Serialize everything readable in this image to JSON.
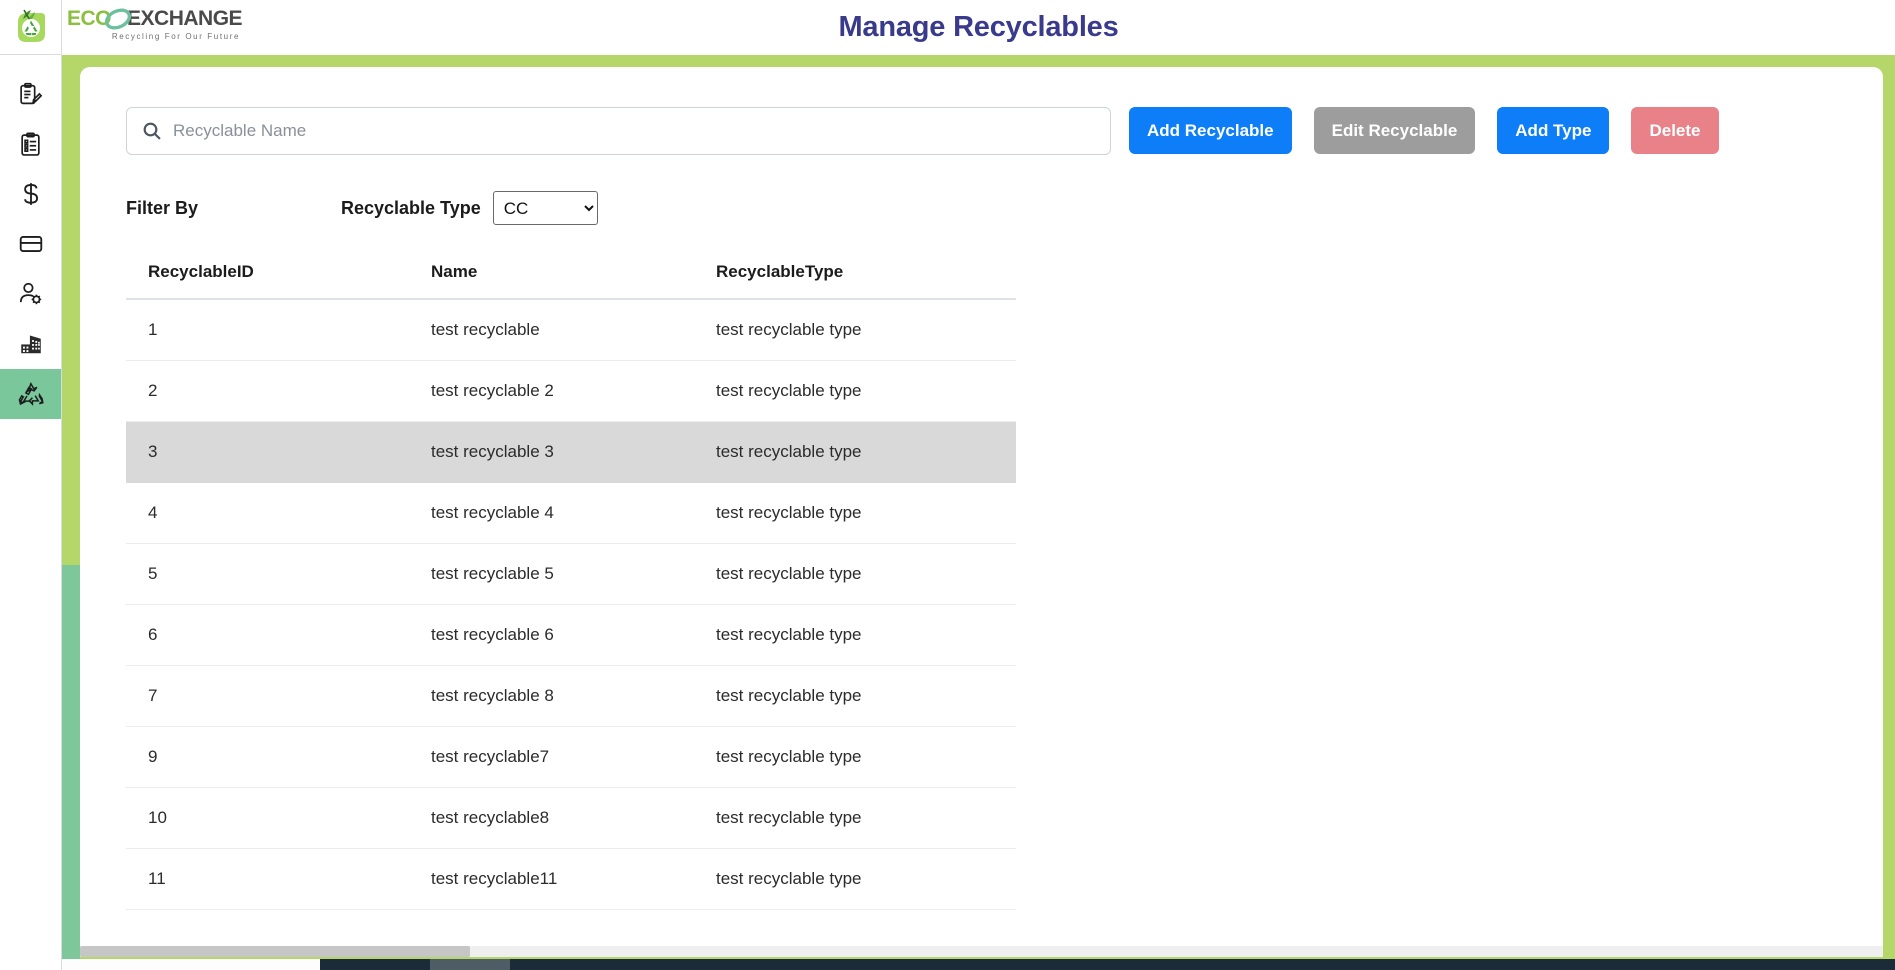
{
  "header": {
    "title": "Manage Recyclables",
    "title_color": "#3a3a8c",
    "logo_primary": "ECO",
    "logo_secondary": "EXCHANGE",
    "logo_tagline": "Recycling For Our Future"
  },
  "sidebar": {
    "items": [
      {
        "name": "clipboard-pencil-icon",
        "label": "Requests",
        "active": false
      },
      {
        "name": "clipboard-list-icon",
        "label": "Orders",
        "active": false
      },
      {
        "name": "dollar-icon",
        "label": "Payments",
        "active": false
      },
      {
        "name": "card-icon",
        "label": "Cards",
        "active": false
      },
      {
        "name": "user-settings-icon",
        "label": "Users",
        "active": false
      },
      {
        "name": "building-icon",
        "label": "Companies",
        "active": false
      },
      {
        "name": "recycle-icon",
        "label": "Recyclables",
        "active": true
      }
    ],
    "active_background": "#79c79b"
  },
  "search": {
    "placeholder": "Recyclable Name",
    "value": "",
    "icon": "search-icon"
  },
  "toolbar": {
    "add_recyclable_label": "Add Recyclable",
    "edit_recyclable_label": "Edit Recyclable",
    "add_type_label": "Add Type",
    "delete_label": "Delete",
    "primary_color": "#0d7ef7",
    "disabled_color": "#9d9d9d",
    "danger_color": "#e98189"
  },
  "filter": {
    "filter_by_label": "Filter By",
    "recyclable_type_label": "Recyclable Type",
    "selected_type": "CC",
    "type_options": [
      "CC"
    ]
  },
  "table": {
    "columns": [
      "RecyclableID",
      "Name",
      "RecyclableType"
    ],
    "selected_row_index": 2,
    "selected_row_color": "#d9d9d9",
    "rows": [
      {
        "id": "1",
        "name": "test recyclable",
        "type": "test recyclable type"
      },
      {
        "id": "2",
        "name": "test recyclable 2",
        "type": "test recyclable type"
      },
      {
        "id": "3",
        "name": "test recyclable 3",
        "type": "test recyclable type"
      },
      {
        "id": "4",
        "name": "test recyclable 4",
        "type": "test recyclable type"
      },
      {
        "id": "5",
        "name": "test recyclable 5",
        "type": "test recyclable type"
      },
      {
        "id": "6",
        "name": "test recyclable 6",
        "type": "test recyclable type"
      },
      {
        "id": "7",
        "name": "test recyclable 8",
        "type": "test recyclable type"
      },
      {
        "id": "9",
        "name": "test recyclable7",
        "type": "test recyclable type"
      },
      {
        "id": "10",
        "name": "test recyclable8",
        "type": "test recyclable type"
      },
      {
        "id": "11",
        "name": "test recyclable11",
        "type": "test recyclable type"
      }
    ]
  },
  "theme": {
    "frame_green": "#b5d668",
    "frame_teal": "#7ec79b"
  }
}
